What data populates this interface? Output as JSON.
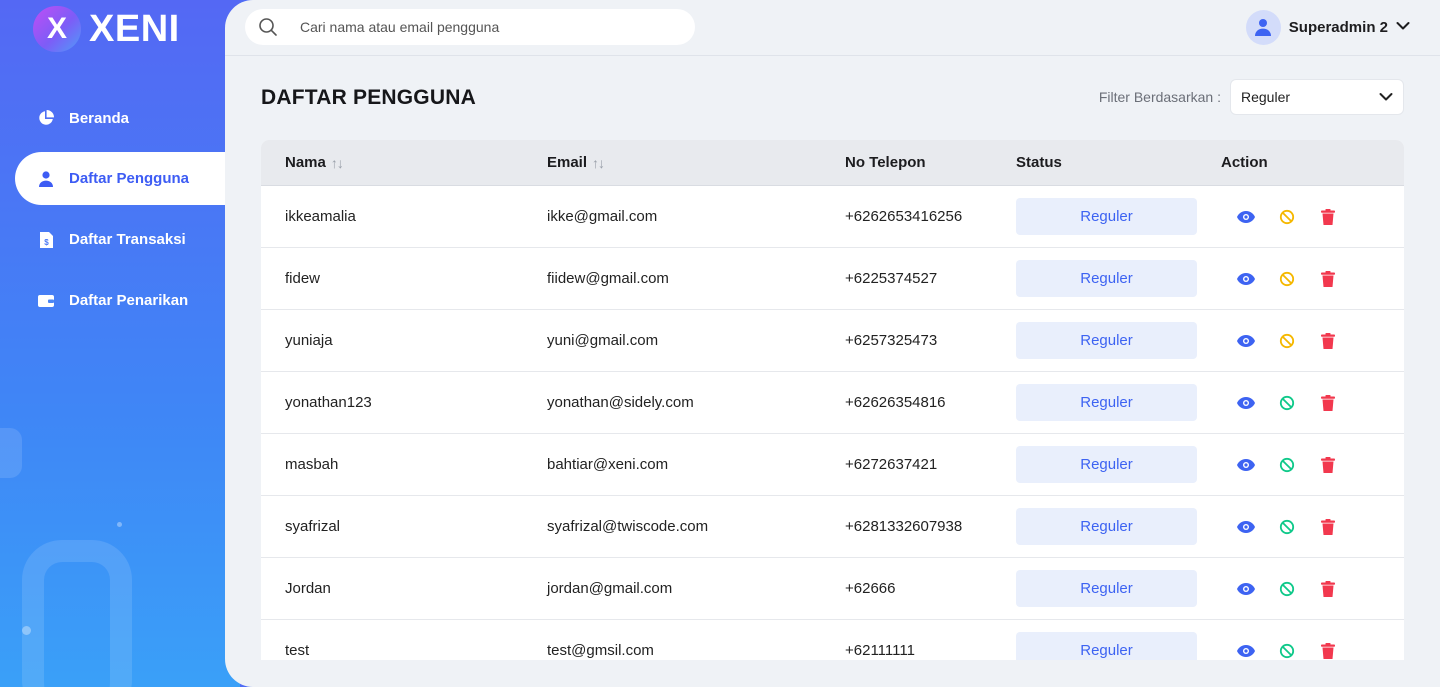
{
  "brand": {
    "name": "XENI",
    "mark": "X"
  },
  "sidebar": {
    "items": [
      {
        "label": "Beranda",
        "icon": "pie-chart-icon",
        "active": false
      },
      {
        "label": "Daftar Pengguna",
        "icon": "user-icon",
        "active": true
      },
      {
        "label": "Daftar Transaksi",
        "icon": "invoice-icon",
        "active": false
      },
      {
        "label": "Daftar Penarikan",
        "icon": "wallet-icon",
        "active": false
      }
    ]
  },
  "header": {
    "search_placeholder": "Cari nama atau email pengguna",
    "user_name": "Superadmin 2"
  },
  "page": {
    "title": "DAFTAR PENGGUNA",
    "filter_label": "Filter Berdasarkan :",
    "filter_value": "Reguler"
  },
  "table": {
    "columns": [
      "Nama",
      "Email",
      "No Telepon",
      "Status",
      "Action"
    ],
    "sort_glyph": "↑↓",
    "rows": [
      {
        "name": "ikkeamalia",
        "email": "ikke@gmail.com",
        "phone": "+6262653416256",
        "status": "Reguler",
        "ban_color": "#f5b800"
      },
      {
        "name": "fidew",
        "email": "fiidew@gmail.com",
        "phone": "+6225374527",
        "status": "Reguler",
        "ban_color": "#f5b800"
      },
      {
        "name": "yuniaja",
        "email": "yuni@gmail.com",
        "phone": "+6257325473",
        "status": "Reguler",
        "ban_color": "#f5b800"
      },
      {
        "name": "yonathan123",
        "email": "yonathan@sidely.com",
        "phone": "+62626354816",
        "status": "Reguler",
        "ban_color": "#10c98a"
      },
      {
        "name": "masbah",
        "email": "bahtiar@xeni.com",
        "phone": "+6272637421",
        "status": "Reguler",
        "ban_color": "#10c98a"
      },
      {
        "name": "syafrizal",
        "email": "syafrizal@twiscode.com",
        "phone": "+6281332607938",
        "status": "Reguler",
        "ban_color": "#10c98a"
      },
      {
        "name": "Jordan",
        "email": "jordan@gmail.com",
        "phone": "+62666",
        "status": "Reguler",
        "ban_color": "#10c98a"
      },
      {
        "name": "test",
        "email": "test@gmsil.com",
        "phone": "+62111111",
        "status": "Reguler",
        "ban_color": "#10c98a"
      }
    ]
  },
  "colors": {
    "accent": "#3d63f2",
    "view": "#3d63f2",
    "delete": "#f2384e"
  }
}
